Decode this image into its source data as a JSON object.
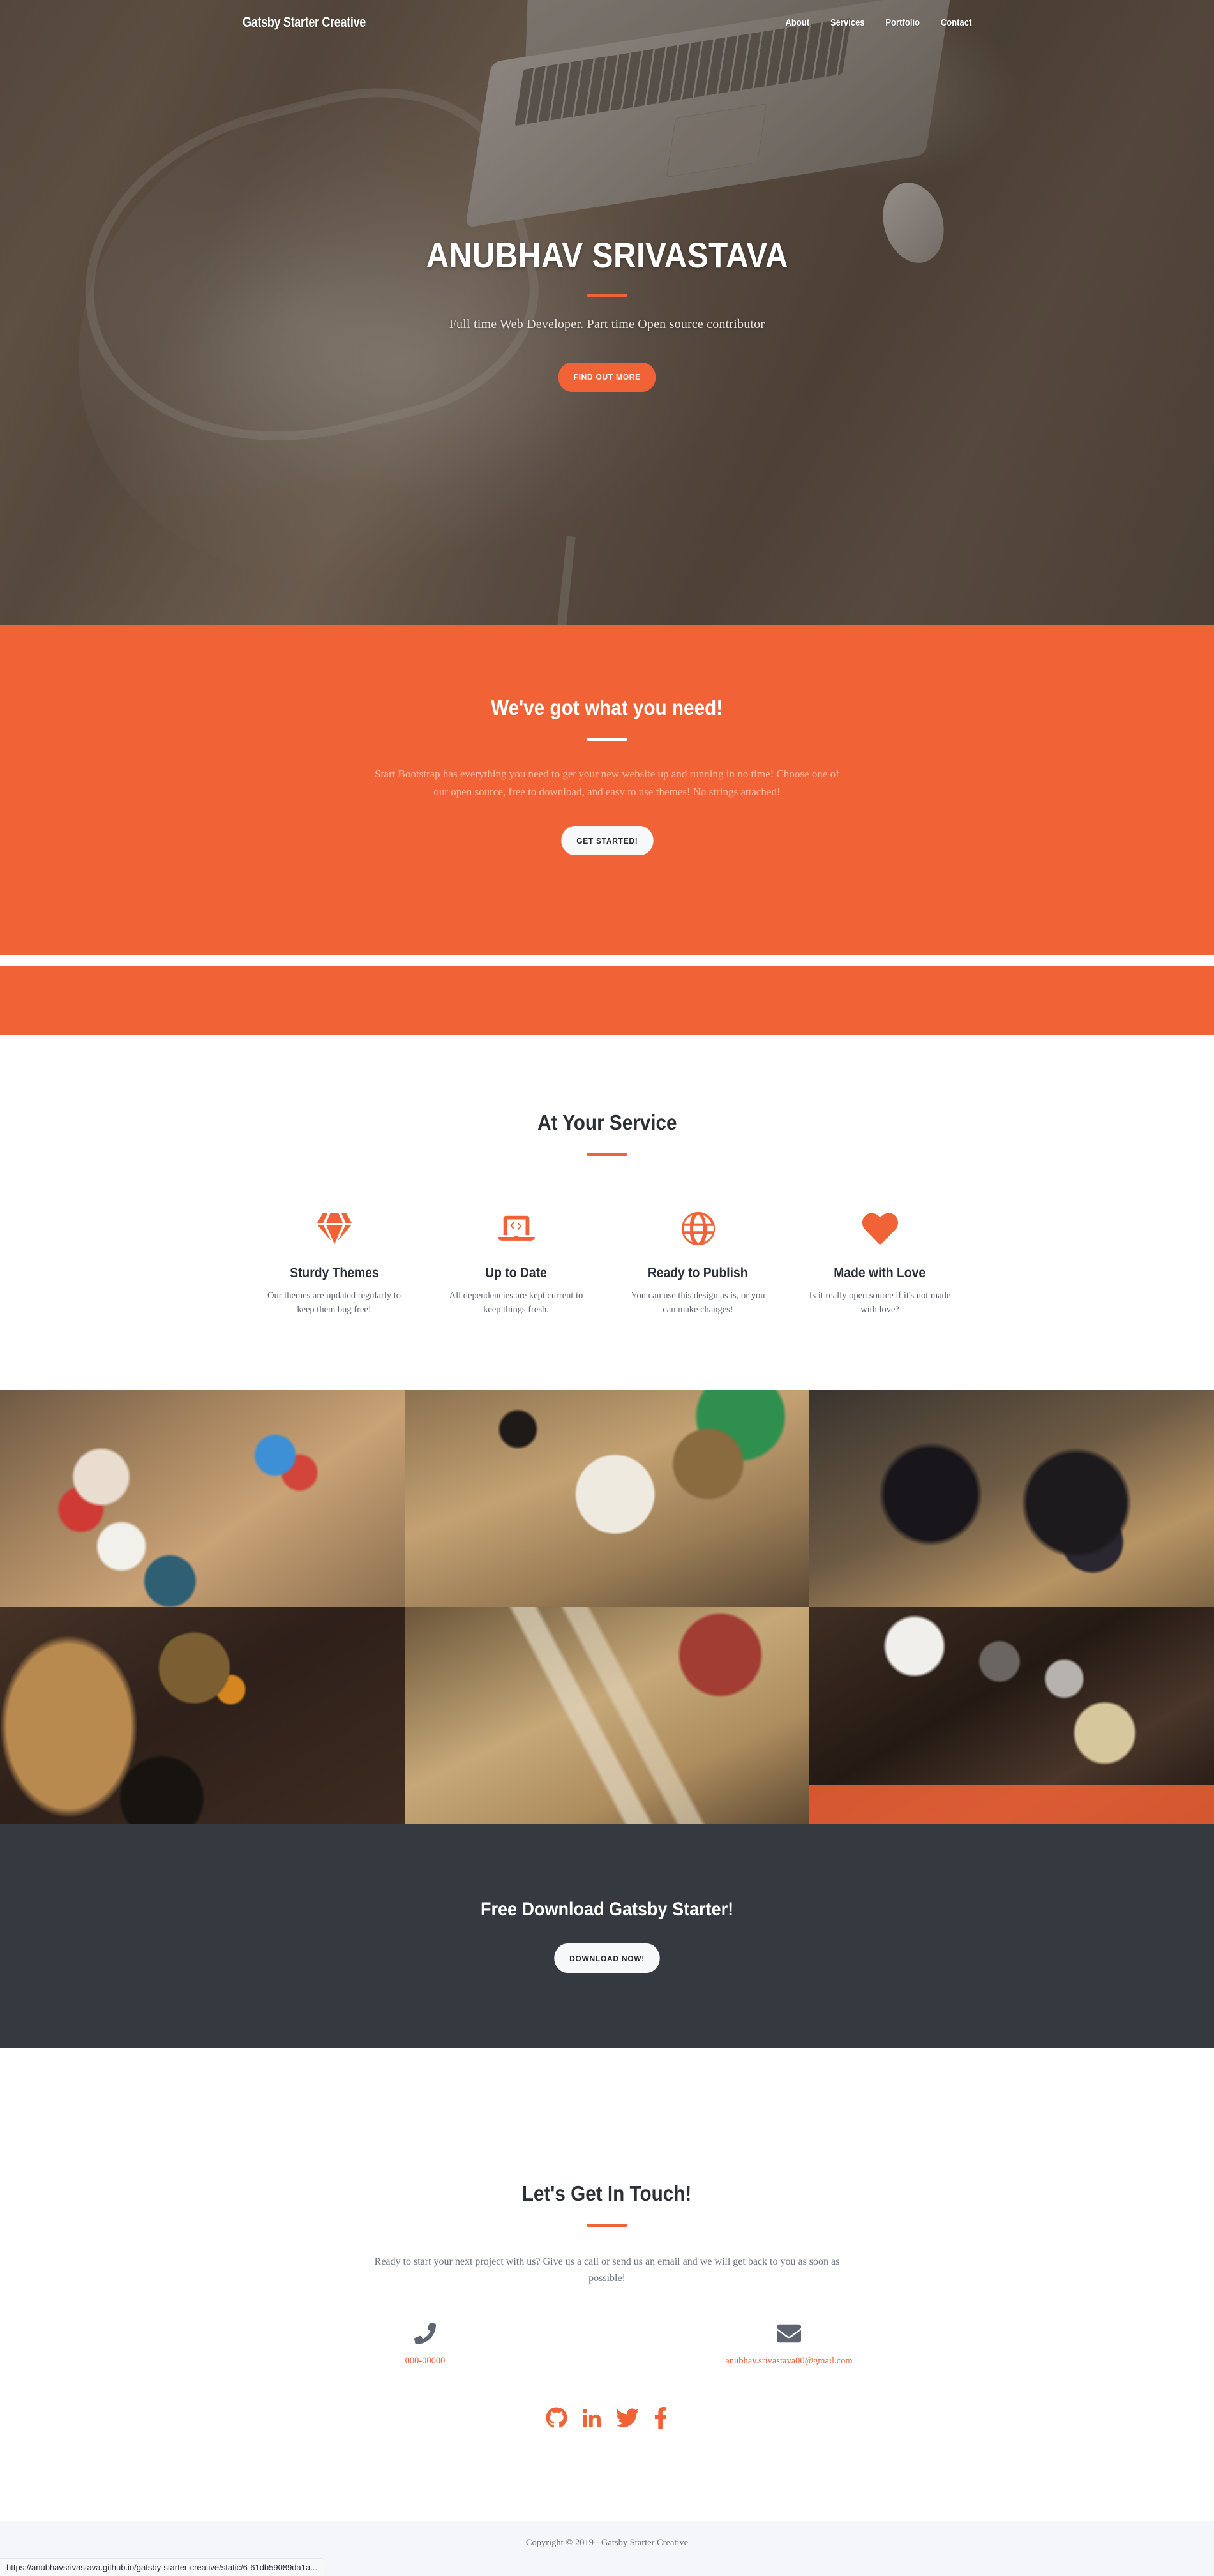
{
  "navbar": {
    "brand": "Gatsby Starter Creative",
    "links": [
      {
        "label": "About"
      },
      {
        "label": "Services"
      },
      {
        "label": "Portfolio"
      },
      {
        "label": "Contact"
      }
    ]
  },
  "hero": {
    "title": "ANUBHAV SRIVASTAVA",
    "subtitle": "Full time Web Developer. Part time Open source contributor",
    "cta": "FIND OUT MORE"
  },
  "about": {
    "title": "We've got what you need!",
    "body": "Start Bootstrap has everything you need to get your new website up and running in no time! Choose one of our open source, free to download, and easy to use themes! No strings attached!",
    "cta": "GET STARTED!"
  },
  "services": {
    "title": "At Your Service",
    "items": [
      {
        "icon": "gem-icon",
        "title": "Sturdy Themes",
        "desc": "Our themes are updated regularly to keep them bug free!"
      },
      {
        "icon": "laptop-code-icon",
        "title": "Up to Date",
        "desc": "All dependencies are kept current to keep things fresh."
      },
      {
        "icon": "globe-icon",
        "title": "Ready to Publish",
        "desc": "You can use this design as is, or you can make changes!"
      },
      {
        "icon": "heart-icon",
        "title": "Made with Love",
        "desc": "Is it really open source if it's not made with love?"
      }
    ]
  },
  "portfolio": {
    "items": [
      {
        "name": "portfolio-item-1",
        "hovered": false
      },
      {
        "name": "portfolio-item-2",
        "hovered": false
      },
      {
        "name": "portfolio-item-3",
        "hovered": false
      },
      {
        "name": "portfolio-item-4",
        "hovered": false
      },
      {
        "name": "portfolio-item-5",
        "hovered": false
      },
      {
        "name": "portfolio-item-6",
        "hovered": true
      }
    ]
  },
  "download": {
    "title": "Free Download Gatsby Starter!",
    "cta": "DOWNLOAD NOW!"
  },
  "contact": {
    "title": "Let's Get In Touch!",
    "body": "Ready to start your next project with us? Give us a call or send us an email and we will get back to you as soon as possible!",
    "phone": "000-00000",
    "email": "anubhav.srivastava00@gmail.com",
    "socials": [
      {
        "icon": "github-icon",
        "label": "GitHub"
      },
      {
        "icon": "linkedin-icon",
        "label": "LinkedIn"
      },
      {
        "icon": "twitter-icon",
        "label": "Twitter"
      },
      {
        "icon": "facebook-icon",
        "label": "Facebook"
      }
    ]
  },
  "footer": {
    "copyright": "Copyright © 2019 - Gatsby Starter Creative"
  },
  "statusbar": {
    "url": "https://anubhavsrivastava.github.io/gatsby-starter-creative/static/6-61db59089da1a..."
  },
  "colors": {
    "accent": "#F26237",
    "dark": "#343A40",
    "footer_bg": "#F4F6F9",
    "muted_text": "#6C737E"
  }
}
